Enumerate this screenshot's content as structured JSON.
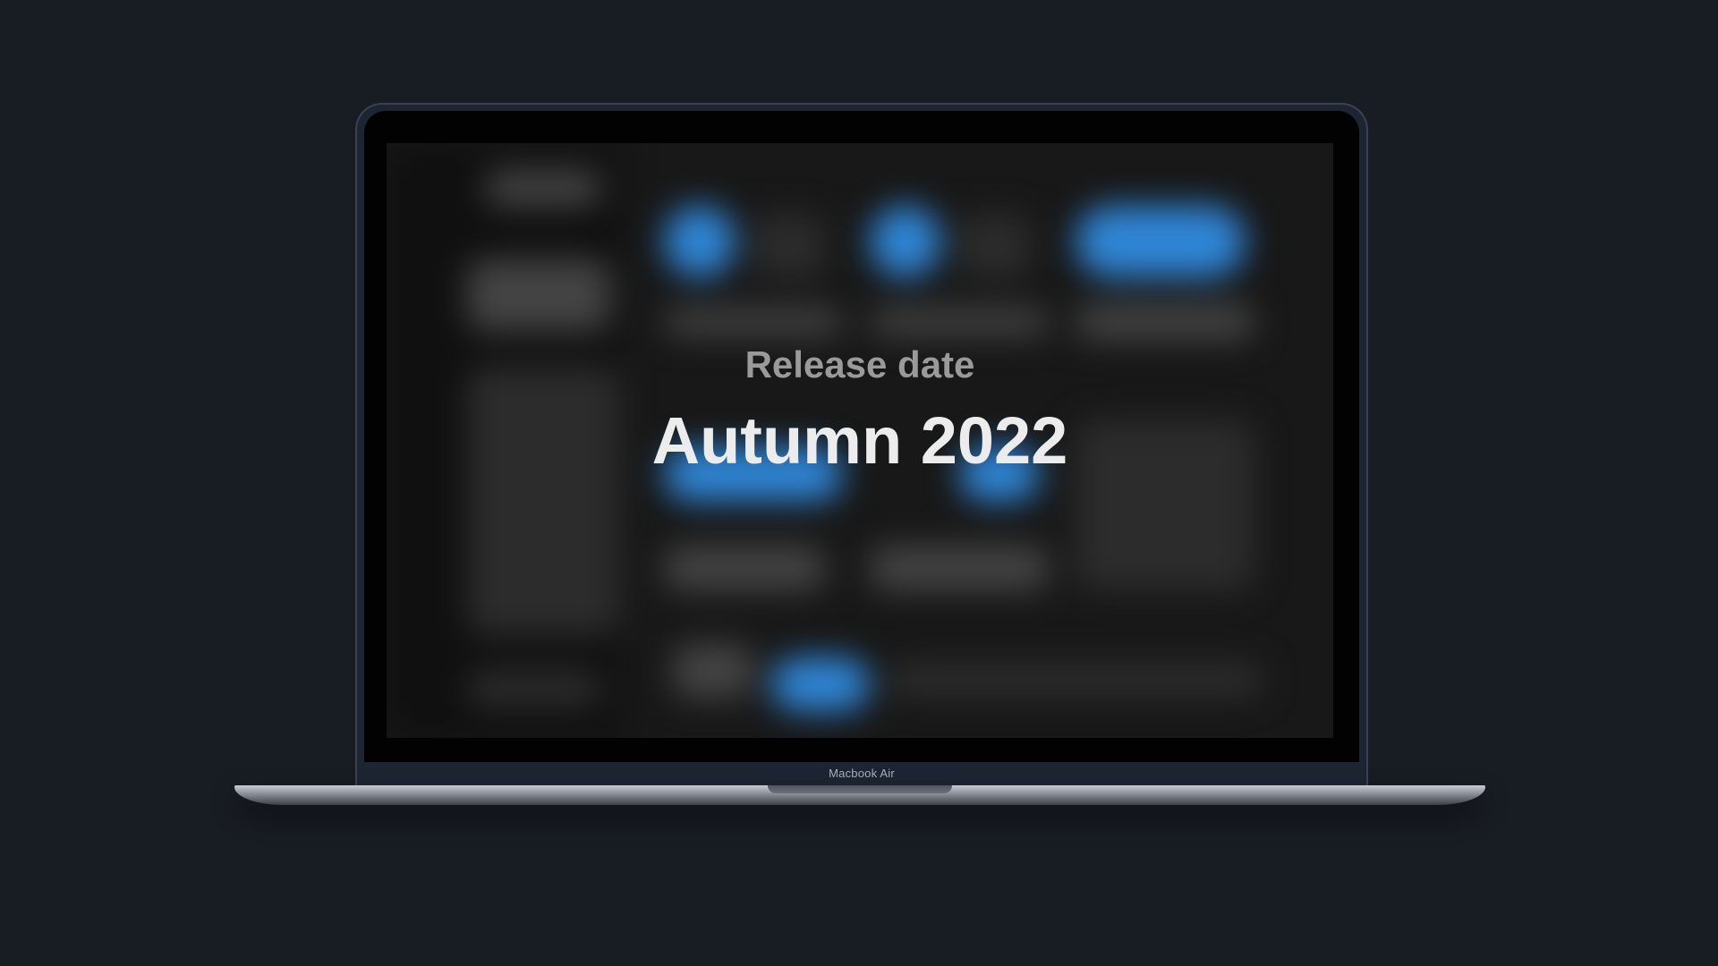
{
  "device": {
    "model_label": "Macbook Air"
  },
  "screen": {
    "subtitle": "Release date",
    "headline": "Autumn 2022"
  },
  "colors": {
    "background": "#181c23",
    "screen_bg": "#181818",
    "accent_blue": "#2f86d6",
    "headline": "#ececec",
    "subtitle": "#9a9a9a"
  }
}
